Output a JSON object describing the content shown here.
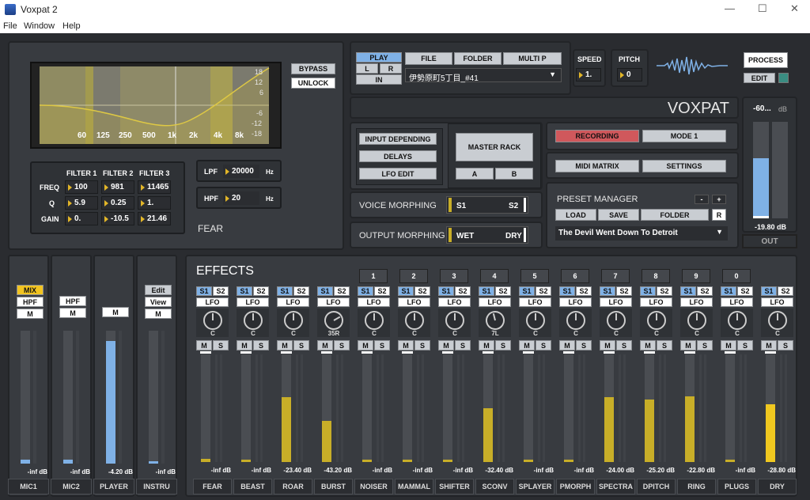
{
  "window": {
    "title": "Voxpat 2"
  },
  "menu": [
    "File",
    "Window",
    "Help"
  ],
  "eq": {
    "bypass": "BYPASS",
    "unlock": "UNLOCK",
    "db_ticks": [
      "18",
      "12",
      "6",
      "-6",
      "-12",
      "-18"
    ],
    "freq_ticks": [
      "60",
      "125",
      "250",
      "500",
      "1k",
      "2k",
      "4k",
      "8k"
    ],
    "filter_headers": [
      "FILTER 1",
      "FILTER 2",
      "FILTER 3"
    ],
    "row_labels": [
      "FREQ",
      "Q",
      "GAIN"
    ],
    "values": [
      [
        "100",
        "981",
        "11465"
      ],
      [
        "5.9",
        "0.25",
        "1."
      ],
      [
        "0.",
        "-10.5",
        "21.46"
      ]
    ],
    "lpf_label": "LPF",
    "lpf_value": "20000",
    "hpf_label": "HPF",
    "hpf_value": "20",
    "hz": "Hz",
    "effect_name": "FEAR"
  },
  "player": {
    "play": "PLAY",
    "l": "L",
    "r": "R",
    "in": "IN",
    "file": "FILE",
    "folder": "FOLDER",
    "multi": "MULTI P",
    "filename": "伊勢原町5丁目_#41",
    "speed_label": "SPEED",
    "speed": "1.",
    "pitch_label": "PITCH",
    "pitch": "0",
    "process": "PROCESS",
    "edit": "EDIT"
  },
  "brand": "VOXPAT",
  "routing": {
    "input_depending": "INPUT DEPENDING",
    "delays": "DELAYS",
    "lfo_edit": "LFO EDIT",
    "master_rack": "MASTER RACK",
    "a": "A",
    "b": "B",
    "voice_morphing": "VOICE MORPHING",
    "s1": "S1",
    "s2": "S2",
    "output_morphing": "OUTPUT MORPHING",
    "wet": "WET",
    "dry": "DRY"
  },
  "right": {
    "recording": "RECORDING",
    "mode": "MODE 1",
    "midi_matrix": "MIDI MATRIX",
    "settings": "SETTINGS",
    "preset_manager": "PRESET MANAGER",
    "minus": "-",
    "plus": "+",
    "load": "LOAD",
    "save": "SAVE",
    "folder": "FOLDER",
    "r": "R",
    "preset": "The Devil Went Down To Detroit"
  },
  "out": {
    "top": "-60...",
    "db": "dB",
    "value": "-19.80 dB",
    "label": "OUT",
    "level": 0.62
  },
  "inputs": [
    {
      "name": "MIC1",
      "db": "-inf dB",
      "level": 0.03,
      "buttons": [
        "MIX",
        "HPF",
        "M"
      ]
    },
    {
      "name": "MIC2",
      "db": "-inf dB",
      "level": 0.03,
      "buttons": [
        "HPF",
        "M"
      ]
    },
    {
      "name": "PLAYER",
      "db": "-4.20 dB",
      "level": 0.92,
      "buttons": [
        "M"
      ]
    },
    {
      "name": "INSTRU",
      "db": "-inf dB",
      "level": 0.02,
      "buttons": [
        "Edit",
        "View",
        "M"
      ]
    }
  ],
  "effects": {
    "title": "EFFECTS",
    "s1": "S1",
    "s2": "S2",
    "lfo": "LFO",
    "m": "M",
    "s": "S",
    "channels": [
      {
        "name": "FEAR",
        "num": "",
        "knob": "C",
        "db": "-inf dB",
        "level": 0.03
      },
      {
        "name": "BEAST",
        "num": "",
        "knob": "C",
        "db": "-inf dB",
        "level": 0.02
      },
      {
        "name": "ROAR",
        "num": "",
        "knob": "C",
        "db": "-23.40 dB",
        "level": 0.6
      },
      {
        "name": "BURST",
        "num": "",
        "knob": "35R",
        "db": "-43.20 dB",
        "level": 0.38
      },
      {
        "name": "NOISER",
        "num": "1",
        "knob": "C",
        "db": "-inf dB",
        "level": 0.02
      },
      {
        "name": "MAMMAL",
        "num": "2",
        "knob": "C",
        "db": "-inf dB",
        "level": 0.02
      },
      {
        "name": "SHIFTER",
        "num": "3",
        "knob": "C",
        "db": "-inf dB",
        "level": 0.02
      },
      {
        "name": "SCONV",
        "num": "4",
        "knob": "7L",
        "db": "-32.40 dB",
        "level": 0.5
      },
      {
        "name": "SPLAYER",
        "num": "5",
        "knob": "C",
        "db": "-inf dB",
        "level": 0.02
      },
      {
        "name": "PMORPH",
        "num": "6",
        "knob": "C",
        "db": "-inf dB",
        "level": 0.02
      },
      {
        "name": "SPECTRA",
        "num": "7",
        "knob": "C",
        "db": "-24.00 dB",
        "level": 0.6
      },
      {
        "name": "DPITCH",
        "num": "8",
        "knob": "C",
        "db": "-25.20 dB",
        "level": 0.58
      },
      {
        "name": "RING",
        "num": "9",
        "knob": "C",
        "db": "-22.80 dB",
        "level": 0.61
      },
      {
        "name": "PLUGS",
        "num": "0",
        "knob": "C",
        "db": "-inf dB",
        "level": 0.02
      },
      {
        "name": "DRY",
        "num": "",
        "knob": "C",
        "db": "-28.80 dB",
        "level": 0.54
      }
    ]
  },
  "colors": {
    "accent_blue": "#7fb1e6",
    "meter_yellow": "#c8ae28",
    "recording_red": "#d0585c"
  }
}
